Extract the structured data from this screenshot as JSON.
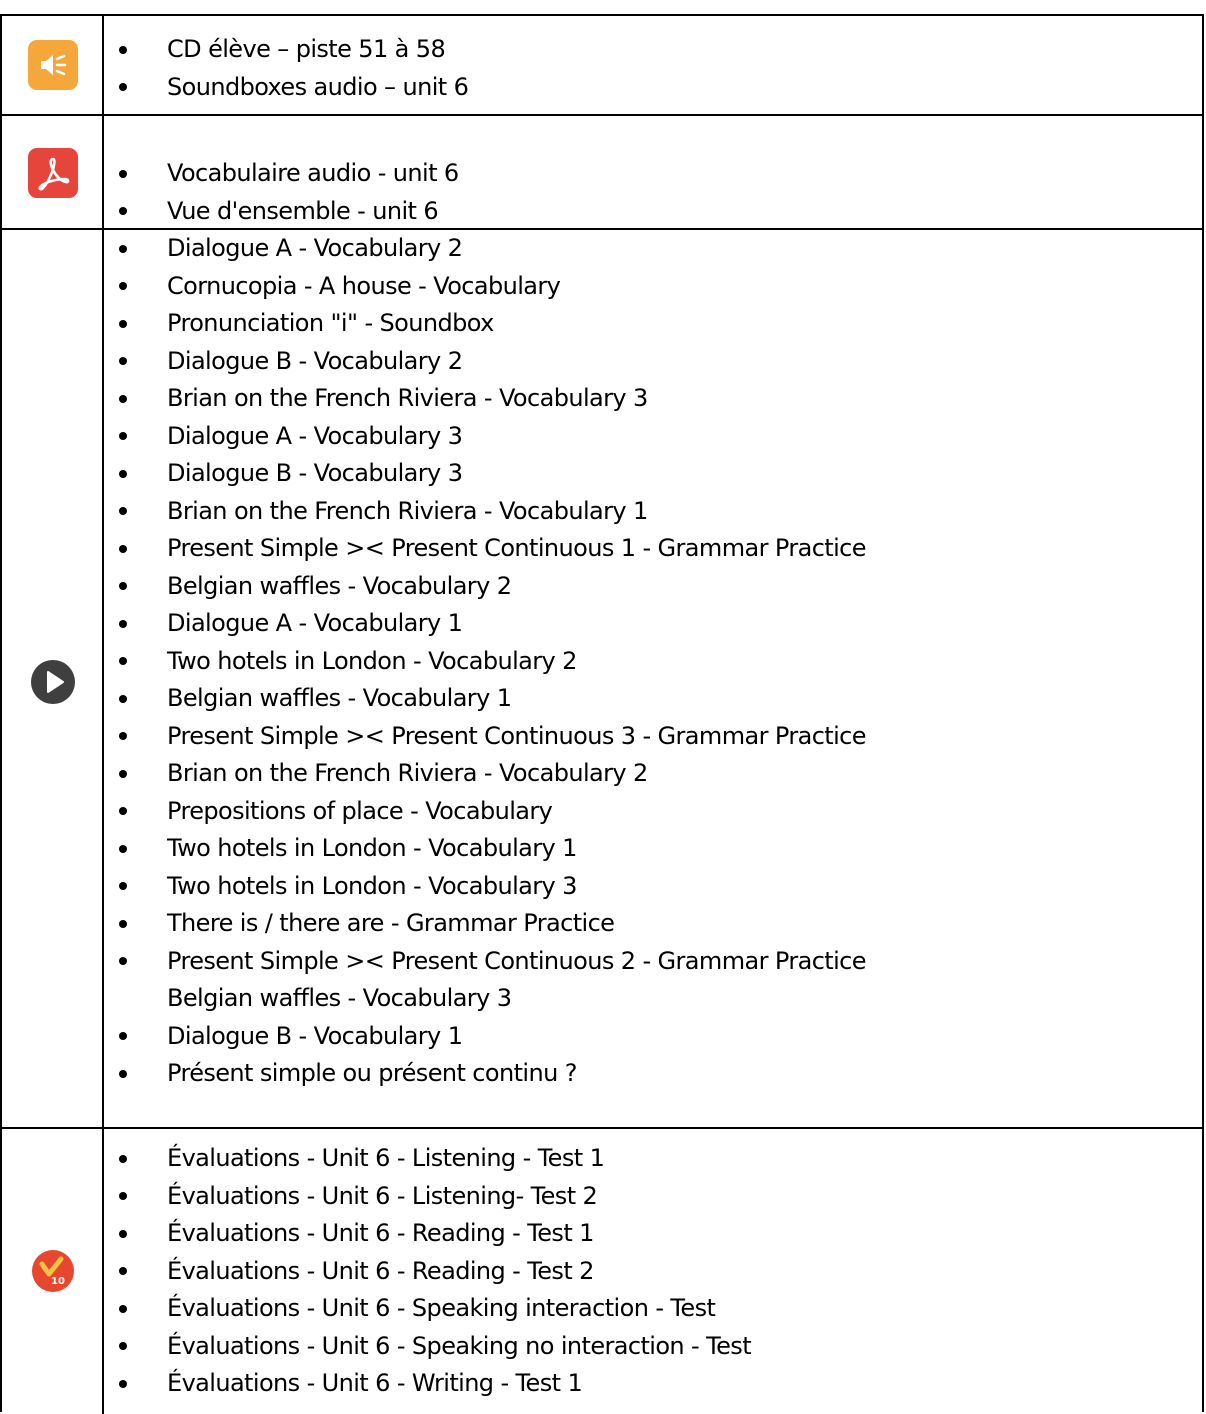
{
  "rows": [
    {
      "icon": "speaker-icon",
      "color": "#F6A73B",
      "items": [
        "CD élève – piste 51 à 58",
        "Soundboxes audio – unit 6"
      ]
    },
    {
      "icon": "pdf-icon",
      "color": "#E5453A",
      "items": [
        "Vocabulaire audio - unit 6",
        "Vue d'ensemble - unit 6"
      ]
    },
    {
      "icon": "play-icon",
      "color": "#3F3F3F",
      "items": [
        "Dialogue A - Vocabulary 2",
        "Cornucopia - A house - Vocabulary",
        "Pronunciation \"i\" - Soundbox",
        "Dialogue B - Vocabulary 2",
        "Brian on the French Riviera - Vocabulary 3",
        "Dialogue A - Vocabulary 3",
        "Dialogue B - Vocabulary 3",
        "Brian on the French Riviera - Vocabulary 1",
        "Present Simple >< Present Continuous 1 - Grammar Practice",
        "Belgian waffles - Vocabulary 2",
        "Dialogue A - Vocabulary 1",
        "Two hotels in London - Vocabulary 2",
        "Belgian waffles - Vocabulary 1",
        "Present Simple >< Present Continuous 3 - Grammar Practice",
        "Brian on the French Riviera - Vocabulary 2",
        "Prepositions of place - Vocabulary",
        "Two hotels in London - Vocabulary 1",
        "Two hotels in London - Vocabulary 3",
        "There is / there are - Grammar Practice",
        "Present Simple >< Present Continuous 2 - Grammar Practice",
        "Belgian waffles - Vocabulary 3",
        "Dialogue B - Vocabulary 1",
        "Présent simple ou présent continu ?"
      ]
    },
    {
      "icon": "evaluation-icon",
      "color": "#E8472F",
      "badge": "10",
      "items": [
        "Évaluations - Unit 6 - Listening - Test 1",
        "Évaluations - Unit 6 - Listening- Test 2",
        "Évaluations - Unit 6 - Reading - Test 1",
        "Évaluations - Unit 6 - Reading - Test 2",
        "Évaluations - Unit 6 - Speaking interaction - Test",
        "Évaluations - Unit 6 - Speaking no interaction - Test",
        "Évaluations - Unit 6 - Writing - Test 1"
      ]
    }
  ]
}
